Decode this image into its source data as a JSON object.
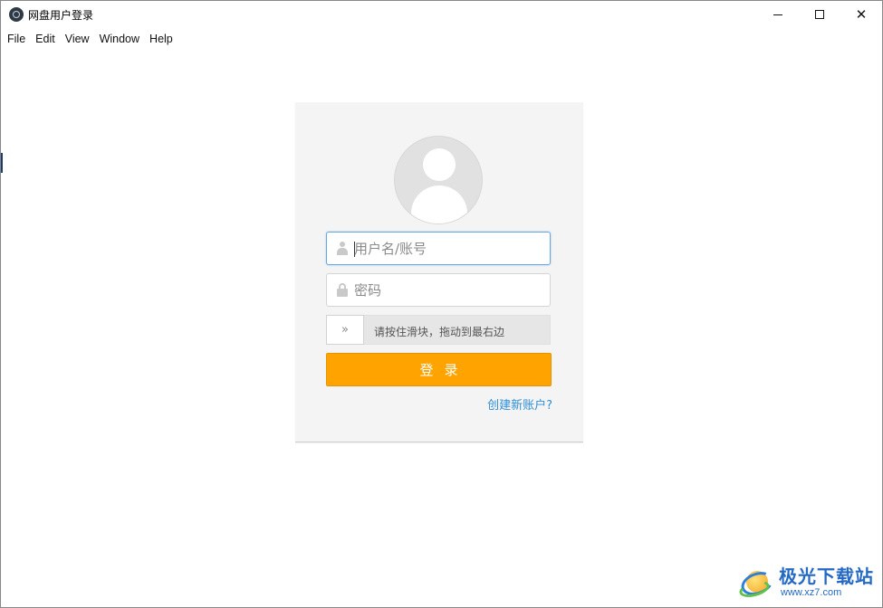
{
  "window": {
    "title": "网盘用户登录",
    "minimize_glyph": "",
    "maximize_glyph": "",
    "close_glyph": "✕"
  },
  "menu": {
    "items": [
      {
        "label": "File"
      },
      {
        "label": "Edit"
      },
      {
        "label": "View"
      },
      {
        "label": "Window"
      },
      {
        "label": "Help"
      }
    ]
  },
  "login": {
    "username": {
      "value": "",
      "placeholder": "用户名/账号",
      "icon": "user-icon"
    },
    "password": {
      "value": "",
      "placeholder": "密码",
      "icon": "lock-icon"
    },
    "slider": {
      "handle_glyph": "»",
      "hint": "请按住滑块，拖动到最右边"
    },
    "submit_label": "登录",
    "register_link": "创建新账户?"
  },
  "watermark": {
    "name": "极光下载站",
    "url": "www.xz7.com"
  },
  "colors": {
    "accent": "#ffa300",
    "link": "#2f8fd6",
    "panel_bg": "#f4f4f4",
    "focus_border": "#6aa6e0"
  }
}
